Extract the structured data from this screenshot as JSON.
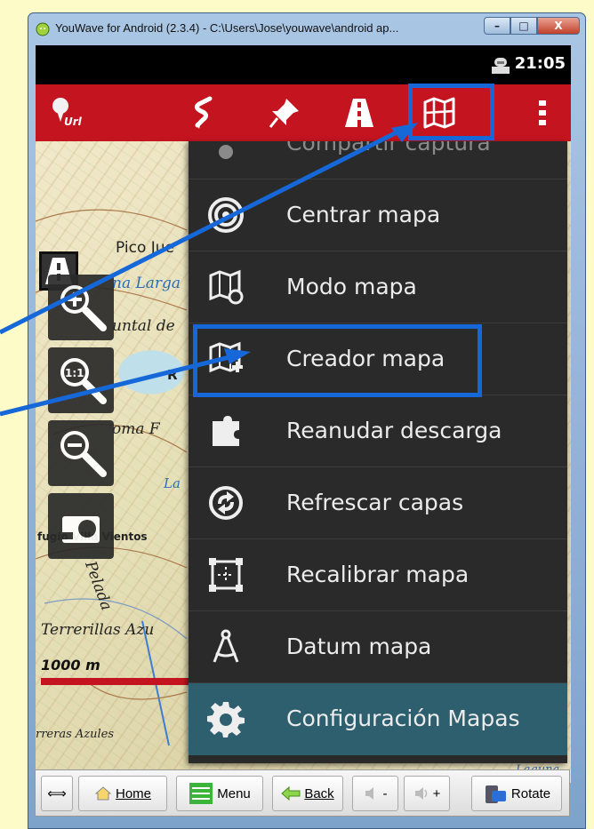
{
  "window": {
    "title": "YouWave for Android (2.3.4) - C:\\Users\\Jose\\youwave\\android ap...",
    "minimize": "–",
    "maximize": "□",
    "close": "X"
  },
  "status": {
    "time": "21:05"
  },
  "map": {
    "labels": {
      "pico": "Pico Jue",
      "laguna_larga": "na Larga",
      "puntal": "untal de",
      "r": "R",
      "loma": "oma F",
      "la": "La",
      "refugio": "fugio Villa Vientos",
      "pelada": "Pelada",
      "terrerillas": "Terrerillas Azu",
      "rreras": "rreras Azules",
      "laguna": "Laguna"
    },
    "scale": "1000 m"
  },
  "menu": {
    "items": [
      {
        "label": "Compartir captura"
      },
      {
        "label": "Centrar mapa"
      },
      {
        "label": "Modo mapa"
      },
      {
        "label": "Creador mapa"
      },
      {
        "label": "Reanudar descarga"
      },
      {
        "label": "Refrescar capas"
      },
      {
        "label": "Recalibrar mapa"
      },
      {
        "label": "Datum mapa"
      },
      {
        "label": "Configuración Mapas"
      }
    ]
  },
  "toolbar": {
    "swap": "⟺",
    "home": "Home",
    "menu": "Menu",
    "back": "Back",
    "vol_down": "-",
    "vol_up": "+",
    "rotate": "Rotate"
  },
  "colors": {
    "actionbar": "#c4141f",
    "highlight": "#1668d8",
    "menu_bg": "#2a2a2a",
    "config_bg": "#2e5f6e"
  }
}
